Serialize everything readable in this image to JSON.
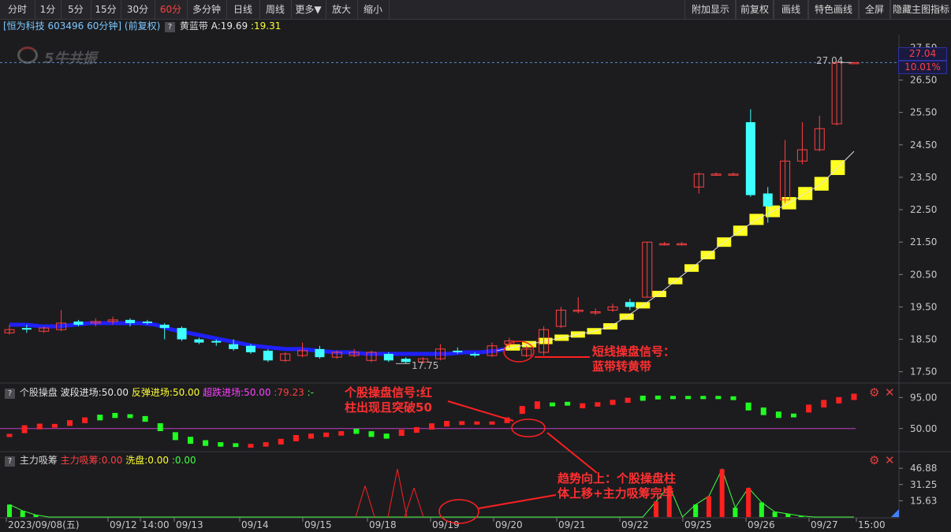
{
  "toolbar": {
    "left": [
      "分时",
      "1分",
      "5分",
      "15分",
      "30分",
      "60分",
      "多分钟",
      "日线",
      "周线",
      "更多▼",
      "放大",
      "缩小"
    ],
    "right": [
      "附加显示",
      "前复权",
      "画线",
      "特色画线",
      "全屏",
      "隐藏主图指标"
    ],
    "active": "60分"
  },
  "main": {
    "stock_title": "[恒为科技 603496 60分钟] (前复权)",
    "indicator_name": "黄蓝带",
    "indicator_a_label": "A:19.69",
    "indicator_b_label": ":19.31",
    "watermark": "5牛共振",
    "price_tag_value": "27.04",
    "price_tag_pct": "10.01%",
    "high_label": "27.04",
    "low_label": "17.75",
    "y_ticks": [
      "27.50",
      "26.50",
      "25.50",
      "24.50",
      "23.50",
      "22.50",
      "21.50",
      "20.50",
      "19.50",
      "18.50",
      "17.50"
    ]
  },
  "panel2": {
    "name": "个股操盘",
    "l1": "波段进场:50.00",
    "l2": "反弹进场:50.00",
    "l3": "超跌进场:50.00",
    "l4": ":79.23",
    "l5": ":-",
    "y_ticks": [
      "95.00",
      "50.00"
    ]
  },
  "panel3": {
    "name": "主力吸筹",
    "l1": "主力吸筹:0.00",
    "l2": "洗盘:0.00",
    "l3": ":0.00",
    "y_ticks": [
      "46.88",
      "31.25",
      "15.63"
    ]
  },
  "xaxis": [
    "2023/09/08(五)",
    "09/12",
    "14:00",
    "09/13",
    "09/14",
    "09/15",
    "09/18",
    "09/19",
    "09/20",
    "09/21",
    "09/22",
    "09/25",
    "09/26",
    "09/27",
    "15:00"
  ],
  "annotations": {
    "a1": [
      "短线操盘信号：",
      "蓝带转黄带"
    ],
    "a2": [
      "个股操盘信号:红",
      "柱出现且突破50"
    ],
    "a3": [
      "趋势向上：个股操盘柱",
      "体上移+主力吸筹完毕"
    ]
  },
  "chart_data": {
    "type": "candlestick",
    "candles": [
      [
        18.7,
        18.8,
        18.95,
        18.65
      ],
      [
        18.85,
        18.8,
        18.95,
        18.7
      ],
      [
        18.75,
        18.85,
        18.9,
        18.7
      ],
      [
        18.8,
        19.0,
        19.4,
        18.75
      ],
      [
        19.05,
        18.95,
        19.1,
        18.9
      ],
      [
        19.0,
        19.05,
        19.15,
        18.9
      ],
      [
        19.05,
        19.1,
        19.2,
        18.95
      ],
      [
        19.1,
        19.0,
        19.15,
        18.9
      ],
      [
        19.05,
        19.0,
        19.1,
        18.95
      ],
      [
        18.95,
        18.85,
        19.0,
        18.5
      ],
      [
        18.85,
        18.5,
        18.9,
        18.45
      ],
      [
        18.5,
        18.4,
        18.55,
        18.35
      ],
      [
        18.45,
        18.4,
        18.5,
        18.3
      ],
      [
        18.35,
        18.2,
        18.5,
        18.15
      ],
      [
        18.3,
        18.1,
        18.35,
        18.05
      ],
      [
        18.15,
        17.85,
        18.2,
        17.8
      ],
      [
        17.85,
        18.05,
        18.1,
        17.8
      ],
      [
        18.0,
        18.15,
        18.4,
        17.95
      ],
      [
        18.2,
        17.95,
        18.3,
        17.9
      ],
      [
        17.95,
        18.1,
        18.15,
        17.9
      ],
      [
        18.0,
        18.1,
        18.2,
        17.95
      ],
      [
        17.85,
        18.1,
        18.15,
        17.8
      ],
      [
        18.05,
        17.85,
        18.1,
        17.8
      ],
      [
        17.9,
        17.8,
        17.95,
        17.75
      ],
      [
        17.8,
        17.9,
        17.95,
        17.75
      ],
      [
        17.9,
        18.2,
        18.35,
        17.85
      ],
      [
        18.15,
        18.1,
        18.25,
        18.05
      ],
      [
        18.05,
        18.0,
        18.1,
        17.95
      ],
      [
        18.0,
        18.3,
        18.4,
        17.95
      ],
      [
        18.35,
        18.45,
        18.55,
        18.25
      ],
      [
        18.0,
        18.2,
        18.3,
        17.95
      ],
      [
        18.1,
        18.8,
        18.9,
        18.0
      ],
      [
        18.9,
        19.4,
        19.5,
        18.85
      ],
      [
        19.4,
        19.4,
        19.8,
        19.3
      ],
      [
        19.35,
        19.35,
        19.45,
        19.25
      ],
      [
        19.4,
        19.5,
        19.6,
        19.35
      ],
      [
        19.65,
        19.5,
        19.75,
        19.4
      ],
      [
        19.8,
        21.5,
        21.5,
        19.8
      ],
      [
        21.45,
        21.45,
        21.5,
        21.4
      ],
      [
        21.45,
        21.45,
        21.5,
        21.4
      ],
      [
        23.2,
        23.6,
        23.65,
        23.0
      ],
      [
        23.6,
        23.6,
        23.65,
        23.55
      ],
      [
        23.6,
        23.6,
        23.65,
        23.55
      ],
      [
        25.2,
        22.95,
        25.6,
        22.9
      ],
      [
        23.0,
        22.6,
        23.2,
        22.1
      ],
      [
        22.8,
        24.0,
        24.65,
        22.7
      ],
      [
        24.0,
        24.35,
        25.2,
        23.9
      ],
      [
        24.35,
        25.0,
        25.4,
        24.3
      ],
      [
        25.15,
        27.04,
        27.04,
        25.1
      ],
      [
        27.04,
        27.04,
        27.04,
        27.04
      ]
    ],
    "band": [
      18.95,
      18.95,
      18.9,
      18.9,
      18.95,
      19.0,
      19.0,
      19.0,
      19.0,
      18.95,
      18.8,
      18.7,
      18.6,
      18.5,
      18.4,
      18.3,
      18.25,
      18.2,
      18.2,
      18.15,
      18.1,
      18.1,
      18.05,
      18.05,
      18.05,
      18.05,
      18.05,
      18.05,
      18.1,
      18.1,
      18.15,
      18.25,
      18.35,
      18.45,
      18.55,
      18.65,
      18.75,
      18.9,
      19.2,
      19.55,
      19.9,
      20.3,
      20.7,
      21.1,
      21.5,
      21.85,
      22.2,
      22.45,
      22.7,
      23.0,
      23.3,
      23.8,
      24.3
    ],
    "band_color": [
      "blue",
      "blue",
      "blue",
      "blue",
      "blue",
      "blue",
      "blue",
      "blue",
      "blue",
      "blue",
      "blue",
      "blue",
      "blue",
      "blue",
      "blue",
      "blue",
      "blue",
      "blue",
      "blue",
      "blue",
      "blue",
      "blue",
      "blue",
      "blue",
      "blue",
      "blue",
      "blue",
      "blue",
      "blue",
      "blue",
      "blue",
      "yellow",
      "yellow",
      "yellow",
      "yellow",
      "yellow",
      "yellow",
      "yellow",
      "yellow",
      "yellow",
      "yellow",
      "yellow",
      "yellow",
      "yellow",
      "yellow",
      "yellow",
      "yellow",
      "yellow",
      "yellow",
      "yellow",
      "yellow",
      "yellow",
      "yellow"
    ],
    "panel2_values": [
      40,
      49,
      53,
      54,
      58,
      62,
      66,
      69,
      68,
      64,
      52,
      39,
      33,
      29,
      27,
      26,
      25,
      27,
      31,
      36,
      39,
      41,
      43,
      46,
      42,
      39,
      44,
      48,
      53,
      57,
      58,
      58,
      58,
      62,
      77,
      84,
      85,
      86,
      83,
      85,
      88,
      91,
      94,
      95,
      95,
      95,
      95,
      95,
      94,
      82,
      75,
      70,
      69,
      79,
      86,
      91,
      96
    ],
    "panel2_colors": [
      "r",
      "r",
      "r",
      "r",
      "r",
      "r",
      "g",
      "g",
      "g",
      "g",
      "g",
      "g",
      "g",
      "g",
      "g",
      "g",
      "r",
      "r",
      "r",
      "r",
      "r",
      "r",
      "r",
      "g",
      "g",
      "g",
      "r",
      "r",
      "r",
      "r",
      "r",
      "r",
      "r",
      "r",
      "r",
      "r",
      "g",
      "g",
      "r",
      "r",
      "r",
      "r",
      "g",
      "g",
      "g",
      "g",
      "g",
      "g",
      "g",
      "g",
      "g",
      "g",
      "g",
      "r",
      "r",
      "r",
      "r"
    ],
    "panel3_values": [
      12,
      6,
      2,
      0,
      0,
      0,
      0,
      0,
      0,
      0,
      0,
      0,
      0,
      0,
      0,
      0,
      0,
      0,
      0,
      0,
      0,
      0,
      0,
      0,
      0,
      0,
      0,
      0,
      0,
      0,
      0,
      0,
      0,
      0,
      0,
      0,
      0,
      0,
      0,
      0,
      0,
      0,
      0,
      0,
      0,
      0,
      0,
      0,
      0,
      15,
      30,
      0,
      12,
      20,
      46,
      9,
      28,
      14,
      5,
      3,
      1,
      0,
      0,
      0,
      0
    ],
    "panel3_colors": [
      "g",
      "g",
      "g",
      "g",
      "g",
      "g",
      "g",
      "g",
      "g",
      "g",
      "g",
      "g",
      "g",
      "g",
      "g",
      "g",
      "g",
      "g",
      "g",
      "g",
      "g",
      "g",
      "g",
      "g",
      "g",
      "g",
      "g",
      "g",
      "g",
      "g",
      "g",
      "g",
      "g",
      "g",
      "g",
      "g",
      "g",
      "g",
      "g",
      "g",
      "g",
      "g",
      "g",
      "g",
      "g",
      "g",
      "g",
      "g",
      "g",
      "r",
      "r",
      "g",
      "g",
      "r",
      "r",
      "g",
      "r",
      "g",
      "g",
      "g",
      "g",
      "g",
      "g",
      "g",
      "g"
    ]
  }
}
